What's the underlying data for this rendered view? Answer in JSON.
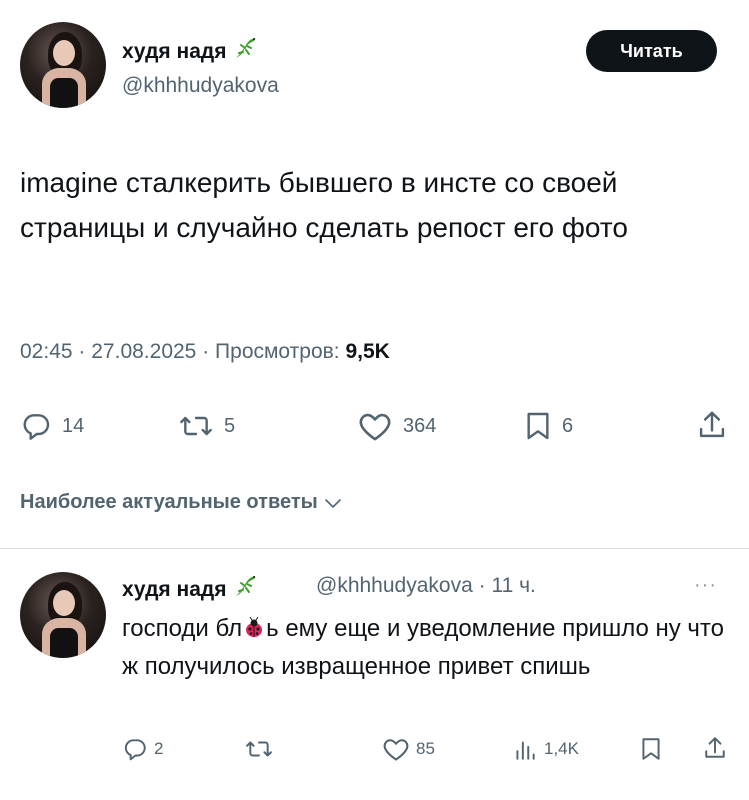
{
  "post": {
    "author_name": "худя надя",
    "author_handle": "@khhhudyakova",
    "follow_label": "Читать",
    "text": "imagine сталкерить бывшего в инсте со своей страницы и случайно сделать репост его фото",
    "time": "02:45",
    "date": "27.08.2025",
    "views_label": "Просмотров:",
    "views_value": "9,5K",
    "separator": "·",
    "actions": {
      "replies": "14",
      "reposts": "5",
      "likes": "364",
      "bookmarks": "6"
    }
  },
  "replies_section": {
    "label": "Наиболее актуальные ответы"
  },
  "reply": {
    "author_name": "худя надя",
    "author_handle": "@khhhudyakova",
    "time_ago": "11 ч.",
    "separator": "·",
    "more_label": "···",
    "text_before": "господи бл",
    "text_after": "ь ему еще и уведомление пришло ну что ж получилось извращенное привет спишь",
    "actions": {
      "replies": "2",
      "reposts": "",
      "likes": "85",
      "views": "1,4K"
    }
  },
  "colors": {
    "text_primary": "#0f1419",
    "text_secondary": "#536471",
    "button_bg": "#0f1419",
    "divider": "#d9dde0",
    "lizard_green": "#3fa02a"
  },
  "icons": [
    "lizard-emoji",
    "reply-icon",
    "repost-icon",
    "like-icon",
    "bookmark-icon",
    "share-icon",
    "views-icon",
    "chevron-down-icon",
    "ladybug-emoji"
  ]
}
